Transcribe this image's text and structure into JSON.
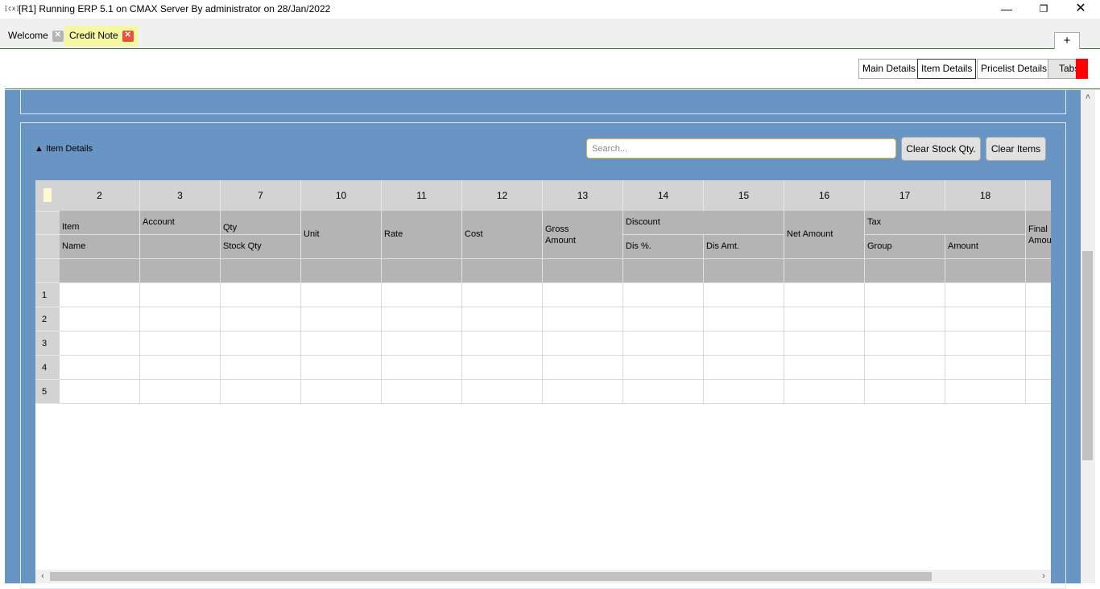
{
  "window": {
    "app_icon": "[cx]",
    "title": "[R1] Running ERP 5.1 on CMAX Server By administrator on 28/Jan/2022",
    "minimize": "—",
    "maximize": "❐",
    "close": "✕"
  },
  "tabs": [
    {
      "label": "Welcome",
      "close": "✕"
    },
    {
      "label": "Credit Note",
      "close": "✕"
    }
  ],
  "add_tab_label": "+",
  "toolbar": {
    "main_details": "Main Details",
    "item_details": "Item Details",
    "pricelist_details": "Pricelist Details",
    "tabs": "Tabs"
  },
  "section": {
    "title": "▲ Item Details",
    "search_placeholder": "Search...",
    "clear_stock_qty": "Clear Stock Qty.",
    "clear_items": "Clear Items"
  },
  "grid": {
    "column_numbers": [
      "2",
      "3",
      "7",
      "10",
      "11",
      "12",
      "13",
      "14",
      "15",
      "16",
      "17",
      "18",
      ""
    ],
    "headers": {
      "item": "Item",
      "name": "Name",
      "account": "Account",
      "qty": "Qty",
      "stock_qty": "Stock Qty",
      "unit": "Unit",
      "rate": "Rate",
      "cost": "Cost",
      "gross_amount": "Gross Amount",
      "discount": "Discount",
      "dis_pct": "Dis %.",
      "dis_amt": "Dis Amt.",
      "net_amount": "Net Amount",
      "tax": "Tax",
      "group": "Group",
      "amount": "Amount",
      "final_amount": "Final Amou"
    },
    "row_numbers": [
      "1",
      "2",
      "3",
      "4",
      "5"
    ]
  },
  "scroll": {
    "left_arrow": "‹",
    "right_arrow": "›",
    "up_arrow": "˄"
  }
}
